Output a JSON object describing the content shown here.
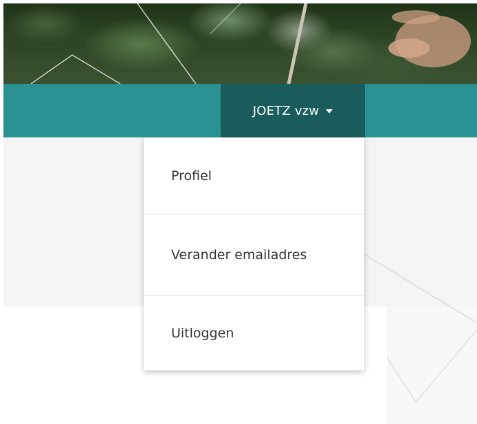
{
  "header": {
    "hero_image": "foliage-photo",
    "user_menu": {
      "label": "JOETZ vzw",
      "caret_icon": "caret-down-icon"
    }
  },
  "dropdown": {
    "items": [
      {
        "label": "Profiel"
      },
      {
        "label": "Verander emailadres"
      },
      {
        "label": "Uitloggen"
      }
    ]
  },
  "colors": {
    "navbar": "#2b9294",
    "navbar_active": "#195c5b",
    "content_bg": "#f4f4f4",
    "menu_text": "#333333"
  }
}
